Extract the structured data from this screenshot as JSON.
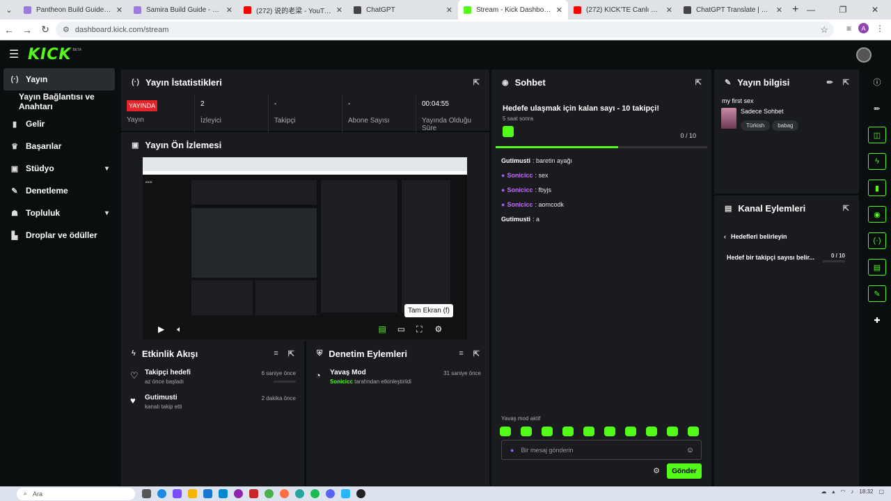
{
  "browser": {
    "tabs": [
      {
        "title": "Pantheon Build Guide - Runes, It",
        "color": "#9c7cdb",
        "active": false
      },
      {
        "title": "Samira Build Guide - Runes, Ite",
        "color": "#9c7cdb",
        "active": false
      },
      {
        "title": "(272) 说的老梁 - YouTube",
        "color": "#ff0000",
        "active": false
      },
      {
        "title": "ChatGPT",
        "color": "#444444",
        "active": false
      },
      {
        "title": "Stream - Kick Dashboard",
        "color": "#53fc18",
        "active": true
      },
      {
        "title": "(272) KICK'TE Canlı Yayın Nasıl",
        "color": "#ff0000",
        "active": false
      },
      {
        "title": "ChatGPT Translate | Hızlı, Doğru",
        "color": "#444444",
        "active": false
      }
    ],
    "url": "dashboard.kick.com/stream",
    "profile_initial": "A"
  },
  "brand": {
    "logo": "KICK",
    "beta": "BETA"
  },
  "sidebar": {
    "items": [
      {
        "label": "Yayın",
        "icon": "broadcast-icon",
        "glyph": "(·)"
      },
      {
        "label": "Yayın Bağlantısı ve Anahtarı",
        "icon": "",
        "glyph": ""
      },
      {
        "label": "Gelir",
        "icon": "chart-icon",
        "glyph": "▮"
      },
      {
        "label": "Başarılar",
        "icon": "trophy-icon",
        "glyph": "♛"
      },
      {
        "label": "Stüdyo",
        "icon": "studio-icon",
        "glyph": "▣"
      },
      {
        "label": "Denetleme",
        "icon": "wrench-icon",
        "glyph": "✎"
      },
      {
        "label": "Topluluk",
        "icon": "people-icon",
        "glyph": "☗"
      },
      {
        "label": "Droplar ve ödüller",
        "icon": "gift-icon",
        "glyph": "▙"
      }
    ]
  },
  "stats": {
    "title": "Yayın İstatistikleri",
    "live_badge": "YAYINDA",
    "items": [
      {
        "value": "",
        "label": "Yayın"
      },
      {
        "value": "2",
        "label": "İzleyici"
      },
      {
        "value": "-",
        "label": "Takipçi"
      },
      {
        "value": "-",
        "label": "Abone Sayısı"
      },
      {
        "value": "00:04:55",
        "label": "Yayında Olduğu Süre"
      }
    ]
  },
  "preview": {
    "title": "Yayın Ön İzlemesi",
    "tooltip": "Tam Ekran (f)"
  },
  "events": {
    "title": "Etkinlik Akışı",
    "items": [
      {
        "title": "Takipçi hedefi",
        "sub": "az önce başladı",
        "time": "6 saniye önce",
        "icon": "heart-outline-icon",
        "glyph": "♡"
      },
      {
        "title": "Gutimusti",
        "sub": "kanalı takip etti",
        "time": "2 dakika önce",
        "icon": "heart-icon",
        "glyph": "♥"
      }
    ]
  },
  "moderation": {
    "title": "Denetim Eylemleri",
    "items": [
      {
        "title": "Yavaş Mod",
        "user": "Sonicicc",
        "sub": " tarafından etkinleştirildi",
        "time": "31 saniye önce"
      }
    ]
  },
  "chat": {
    "title": "Sohbet",
    "goal_title": "Hedefe ulaşmak için kalan sayı - 10 takipçi!",
    "goal_time": "5 saat sonra",
    "goal_count": "0 / 10",
    "goal_progress": 0.58,
    "messages": [
      {
        "user": "Gutimusti",
        "text": "baretin ayağı",
        "color": "#ffffff",
        "mic": false
      },
      {
        "user": "Sonicicc",
        "text": "sex",
        "color": "#c86cff",
        "mic": true
      },
      {
        "user": "Sonicicc",
        "text": "fbyjs",
        "color": "#c86cff",
        "mic": true
      },
      {
        "user": "Sonicicc",
        "text": "aomcodk",
        "color": "#c86cff",
        "mic": true
      },
      {
        "user": "Gutimusti",
        "text": "a",
        "color": "#ffffff",
        "mic": false
      }
    ],
    "slow_mode": "Yavaş mod aktif",
    "placeholder": "Bir mesaj gönderin",
    "send": "Gönder"
  },
  "stream_info": {
    "title": "Yayın bilgisi",
    "name": "my first sex",
    "category": "Sadece Sohbet",
    "tags": [
      "Türkish",
      "babag"
    ]
  },
  "channel_actions": {
    "title": "Kanal Eylemleri",
    "back": "Hedefleri belirleyin",
    "row_label": "Hedef bir takipçi sayısı belir...",
    "row_count": "0 / 10"
  },
  "taskbar": {
    "search": "Ara",
    "time": "18:32"
  },
  "colors": {
    "accent": "#53fc18",
    "live": "#e5232b",
    "panel": "#191b1f"
  }
}
